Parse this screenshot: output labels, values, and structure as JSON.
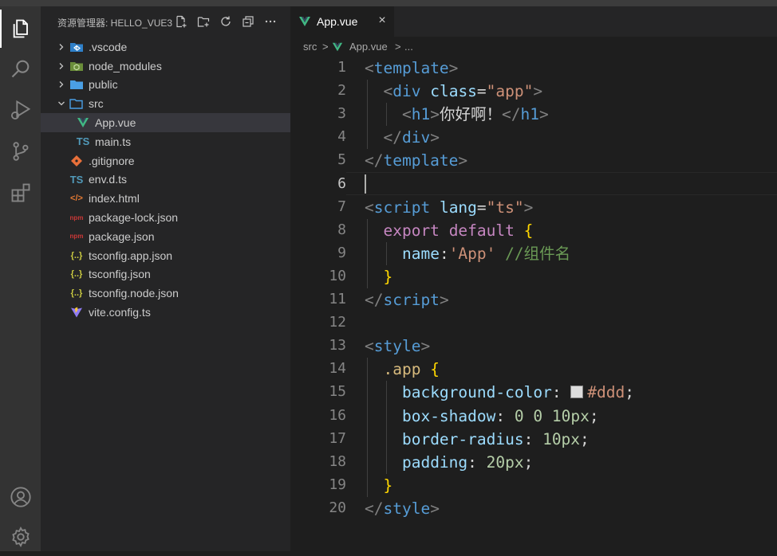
{
  "explorer": {
    "title": "资源管理器: HELLO_VUE3",
    "items": [
      {
        "name": ".vscode",
        "kind": "folder",
        "icon": "vscode-folder-icon",
        "expanded": false,
        "depth": 0
      },
      {
        "name": "node_modules",
        "kind": "folder",
        "icon": "node-folder-icon",
        "expanded": false,
        "depth": 0
      },
      {
        "name": "public",
        "kind": "folder",
        "icon": "folder-icon",
        "expanded": false,
        "depth": 0
      },
      {
        "name": "src",
        "kind": "folder",
        "icon": "folder-open-icon",
        "expanded": true,
        "depth": 0
      },
      {
        "name": "App.vue",
        "kind": "file",
        "icon": "vue-icon",
        "depth": 1,
        "selected": true
      },
      {
        "name": "main.ts",
        "kind": "file",
        "icon": "typescript-icon",
        "icon_text": "TS",
        "depth": 1
      },
      {
        "name": ".gitignore",
        "kind": "file",
        "icon": "git-icon",
        "depth": 0
      },
      {
        "name": "env.d.ts",
        "kind": "file",
        "icon": "typescript-icon",
        "icon_text": "TS",
        "depth": 0
      },
      {
        "name": "index.html",
        "kind": "file",
        "icon": "html-icon",
        "icon_text": "</>",
        "depth": 0
      },
      {
        "name": "package-lock.json",
        "kind": "file",
        "icon": "npm-icon",
        "icon_text": "npm",
        "depth": 0
      },
      {
        "name": "package.json",
        "kind": "file",
        "icon": "npm-icon",
        "icon_text": "npm",
        "depth": 0
      },
      {
        "name": "tsconfig.app.json",
        "kind": "file",
        "icon": "json-icon",
        "icon_text": "{..}",
        "depth": 0
      },
      {
        "name": "tsconfig.json",
        "kind": "file",
        "icon": "json-icon",
        "icon_text": "{..}",
        "depth": 0
      },
      {
        "name": "tsconfig.node.json",
        "kind": "file",
        "icon": "json-icon",
        "icon_text": "{..}",
        "depth": 0
      },
      {
        "name": "vite.config.ts",
        "kind": "file",
        "icon": "vite-icon",
        "depth": 0
      }
    ]
  },
  "tab": {
    "label": "App.vue",
    "close": "×"
  },
  "breadcrumb": {
    "folder": "src",
    "sep1": ">",
    "file": "App.vue",
    "sep2": ">",
    "more": "..."
  },
  "editor": {
    "current_line": 6,
    "lines": [
      {
        "n": "1",
        "tokens": [
          [
            "tg",
            "<"
          ],
          [
            "tn",
            "template"
          ],
          [
            "tg",
            ">"
          ]
        ]
      },
      {
        "n": "2",
        "tokens": [
          [
            "tx",
            "  "
          ],
          [
            "tg",
            "<"
          ],
          [
            "tn",
            "div"
          ],
          [
            "tx",
            " "
          ],
          [
            "at",
            "class"
          ],
          [
            "tx",
            "="
          ],
          [
            "st",
            "\"app\""
          ],
          [
            "tg",
            ">"
          ]
        ]
      },
      {
        "n": "3",
        "tokens": [
          [
            "tx",
            "    "
          ],
          [
            "tg",
            "<"
          ],
          [
            "tn",
            "h1"
          ],
          [
            "tg",
            ">"
          ],
          [
            "tx",
            "你好啊！"
          ],
          [
            "tg",
            "</"
          ],
          [
            "tn",
            "h1"
          ],
          [
            "tg",
            ">"
          ]
        ]
      },
      {
        "n": "4",
        "tokens": [
          [
            "tx",
            "  "
          ],
          [
            "tg",
            "</"
          ],
          [
            "tn",
            "div"
          ],
          [
            "tg",
            ">"
          ]
        ]
      },
      {
        "n": "5",
        "tokens": [
          [
            "tg",
            "</"
          ],
          [
            "tn",
            "template"
          ],
          [
            "tg",
            ">"
          ]
        ]
      },
      {
        "n": "6",
        "tokens": []
      },
      {
        "n": "7",
        "tokens": [
          [
            "tg",
            "<"
          ],
          [
            "tn",
            "script"
          ],
          [
            "tx",
            " "
          ],
          [
            "at",
            "lang"
          ],
          [
            "tx",
            "="
          ],
          [
            "st",
            "\"ts\""
          ],
          [
            "tg",
            ">"
          ]
        ]
      },
      {
        "n": "8",
        "tokens": [
          [
            "tx",
            "  "
          ],
          [
            "kw",
            "export"
          ],
          [
            "tx",
            " "
          ],
          [
            "kw",
            "default"
          ],
          [
            "tx",
            " "
          ],
          [
            "br",
            "{"
          ]
        ]
      },
      {
        "n": "9",
        "tokens": [
          [
            "tx",
            "    "
          ],
          [
            "pr",
            "name"
          ],
          [
            "tx",
            ":"
          ],
          [
            "st",
            "'App'"
          ],
          [
            "tx",
            " "
          ],
          [
            "cm",
            "//组件名"
          ]
        ]
      },
      {
        "n": "10",
        "tokens": [
          [
            "tx",
            "  "
          ],
          [
            "br",
            "}"
          ]
        ]
      },
      {
        "n": "11",
        "tokens": [
          [
            "tg",
            "</"
          ],
          [
            "tn",
            "script"
          ],
          [
            "tg",
            ">"
          ]
        ]
      },
      {
        "n": "12",
        "tokens": []
      },
      {
        "n": "13",
        "tokens": [
          [
            "tg",
            "<"
          ],
          [
            "tn",
            "style"
          ],
          [
            "tg",
            ">"
          ]
        ]
      },
      {
        "n": "14",
        "tokens": [
          [
            "tx",
            "  "
          ],
          [
            "cs",
            ".app"
          ],
          [
            "tx",
            " "
          ],
          [
            "br",
            "{"
          ]
        ]
      },
      {
        "n": "15",
        "tokens": [
          [
            "tx",
            "    "
          ],
          [
            "pr",
            "background-color"
          ],
          [
            "tx",
            ": "
          ],
          [
            "sw",
            ""
          ],
          [
            "st",
            "#ddd"
          ],
          [
            "tx",
            ";"
          ]
        ]
      },
      {
        "n": "16",
        "tokens": [
          [
            "tx",
            "    "
          ],
          [
            "pr",
            "box-shadow"
          ],
          [
            "tx",
            ": "
          ],
          [
            "nm",
            "0"
          ],
          [
            "tx",
            " "
          ],
          [
            "nm",
            "0"
          ],
          [
            "tx",
            " "
          ],
          [
            "nm",
            "10px"
          ],
          [
            "tx",
            ";"
          ]
        ]
      },
      {
        "n": "17",
        "tokens": [
          [
            "tx",
            "    "
          ],
          [
            "pr",
            "border-radius"
          ],
          [
            "tx",
            ": "
          ],
          [
            "nm",
            "10px"
          ],
          [
            "tx",
            ";"
          ]
        ]
      },
      {
        "n": "18",
        "tokens": [
          [
            "tx",
            "    "
          ],
          [
            "pr",
            "padding"
          ],
          [
            "tx",
            ": "
          ],
          [
            "nm",
            "20px"
          ],
          [
            "tx",
            ";"
          ]
        ]
      },
      {
        "n": "19",
        "tokens": [
          [
            "tx",
            "  "
          ],
          [
            "br",
            "}"
          ]
        ]
      },
      {
        "n": "20",
        "tokens": [
          [
            "tg",
            "</"
          ],
          [
            "tn",
            "style"
          ],
          [
            "tg",
            ">"
          ]
        ]
      }
    ]
  },
  "colors": {
    "activity_bar": "#333333",
    "sidebar": "#252526",
    "editor": "#1e1e1e",
    "vue_green": "#41b883",
    "ts_blue": "#519aba",
    "folder_blue": "#4a9fe5"
  }
}
